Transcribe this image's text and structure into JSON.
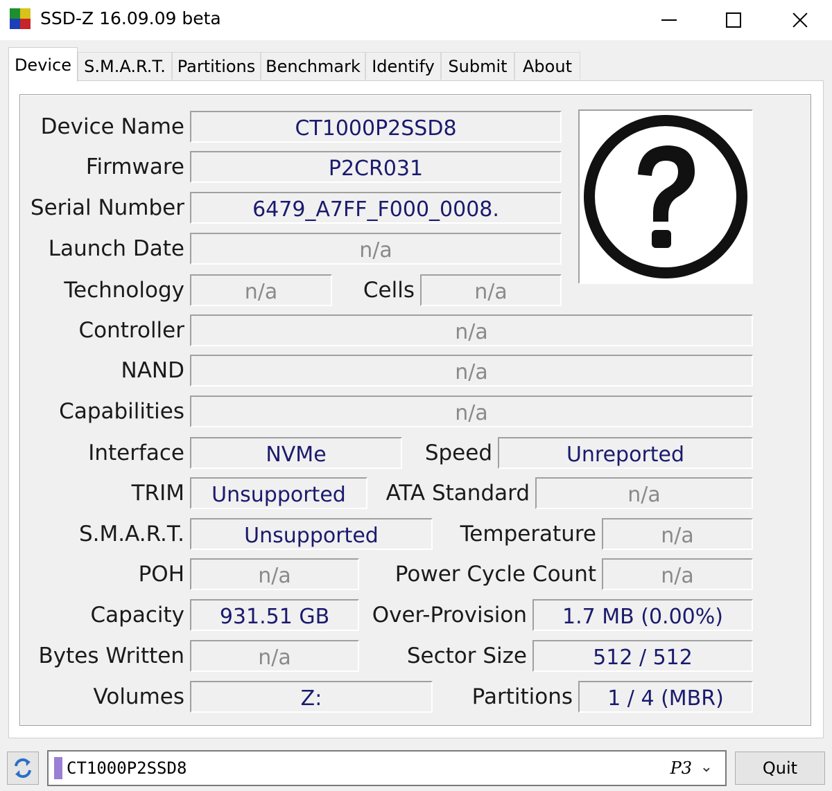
{
  "window": {
    "title": "SSD-Z 16.09.09 beta"
  },
  "tabs": [
    {
      "label": "Device"
    },
    {
      "label": "S.M.A.R.T."
    },
    {
      "label": "Partitions"
    },
    {
      "label": "Benchmark"
    },
    {
      "label": "Identify"
    },
    {
      "label": "Submit"
    },
    {
      "label": "About"
    }
  ],
  "active_tab": "Device",
  "device": {
    "device_name": {
      "label": "Device Name",
      "value": "CT1000P2SSD8"
    },
    "firmware": {
      "label": "Firmware",
      "value": "P2CR031"
    },
    "serial_number": {
      "label": "Serial Number",
      "value": "6479_A7FF_F000_0008."
    },
    "launch_date": {
      "label": "Launch Date",
      "value": "n/a"
    },
    "technology": {
      "label": "Technology",
      "value": "n/a"
    },
    "cells": {
      "label": "Cells",
      "value": "n/a"
    },
    "controller": {
      "label": "Controller",
      "value": "n/a"
    },
    "nand": {
      "label": "NAND",
      "value": "n/a"
    },
    "capabilities": {
      "label": "Capabilities",
      "value": "n/a"
    },
    "interface": {
      "label": "Interface",
      "value": "NVMe"
    },
    "speed": {
      "label": "Speed",
      "value": "Unreported"
    },
    "trim": {
      "label": "TRIM",
      "value": "Unsupported"
    },
    "ata_standard": {
      "label": "ATA Standard",
      "value": "n/a"
    },
    "smart": {
      "label": "S.M.A.R.T.",
      "value": "Unsupported"
    },
    "temperature": {
      "label": "Temperature",
      "value": "n/a"
    },
    "poh": {
      "label": "POH",
      "value": "n/a"
    },
    "power_cycle_count": {
      "label": "Power Cycle Count",
      "value": "n/a"
    },
    "capacity": {
      "label": "Capacity",
      "value": "931.51 GB"
    },
    "over_provision": {
      "label": "Over-Provision",
      "value": "1.7 MB (0.00%)"
    },
    "bytes_written": {
      "label": "Bytes Written",
      "value": "n/a"
    },
    "sector_size": {
      "label": "Sector Size",
      "value": "512 / 512"
    },
    "volumes": {
      "label": "Volumes",
      "value": "Z:"
    },
    "partitions": {
      "label": "Partitions",
      "value": "1 / 4 (MBR)"
    }
  },
  "bottom": {
    "selected_drive": "CT1000P2SSD8",
    "drive_tag": "P3",
    "quit_label": "Quit"
  },
  "colors": {
    "value_text": "#1a1a6e",
    "na_text": "#8a8a8a",
    "drive_marker": "#9b7fd4"
  }
}
